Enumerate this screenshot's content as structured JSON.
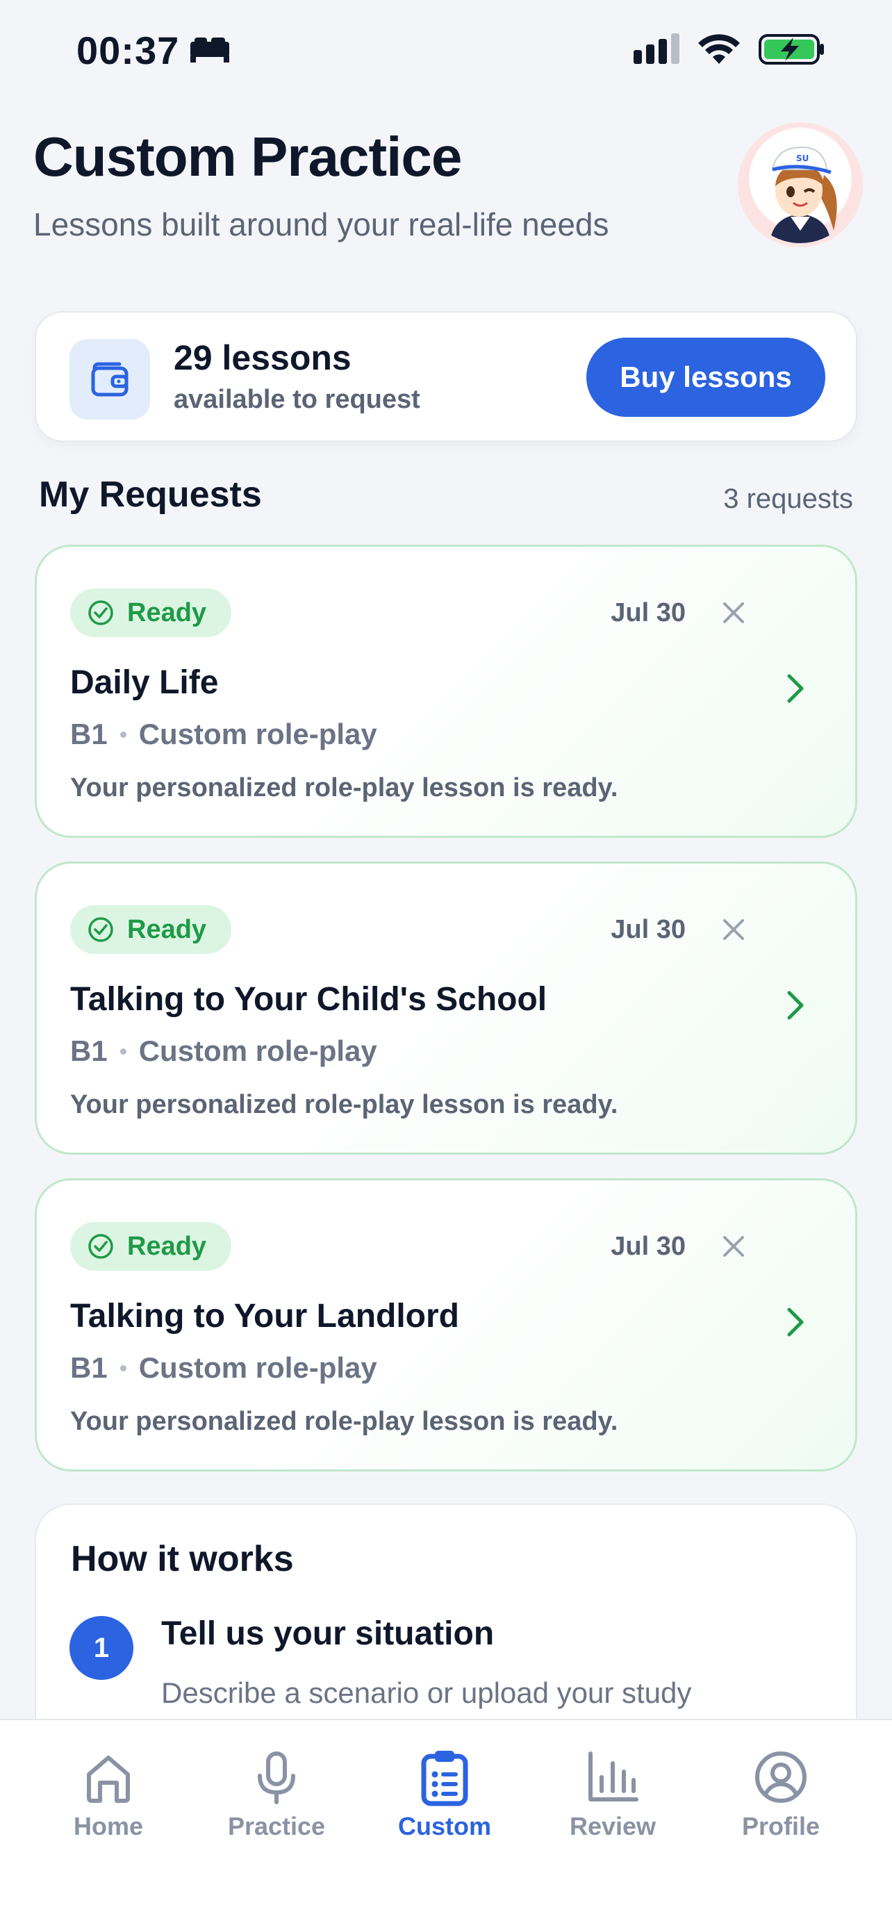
{
  "status_bar": {
    "time": "00:37"
  },
  "header": {
    "title": "Custom Practice",
    "subtitle": "Lessons built around your real-life needs"
  },
  "balance": {
    "count_label": "29 lessons",
    "sub_label": "available to request",
    "buy_label": "Buy lessons",
    "icon": "wallet-icon"
  },
  "requests_section": {
    "title": "My Requests",
    "count_label": "3 requests"
  },
  "requests": [
    {
      "status": "Ready",
      "date": "Jul 30",
      "title": "Daily Life",
      "level": "B1",
      "type": "Custom role-play",
      "description": "Your personalized role-play lesson is ready."
    },
    {
      "status": "Ready",
      "date": "Jul 30",
      "title": "Talking to Your Child's School",
      "level": "B1",
      "type": "Custom role-play",
      "description": "Your personalized role-play lesson is ready."
    },
    {
      "status": "Ready",
      "date": "Jul 30",
      "title": "Talking to Your Landlord",
      "level": "B1",
      "type": "Custom role-play",
      "description": "Your personalized role-play lesson is ready."
    }
  ],
  "how_it_works": {
    "title": "How it works",
    "steps": [
      {
        "number": "1",
        "title": "Tell us your situation",
        "description": "Describe a scenario or upload your study materials, and we'll build a custom lesson"
      }
    ]
  },
  "tabbar": {
    "items": [
      {
        "label": "Home",
        "icon": "home-icon"
      },
      {
        "label": "Practice",
        "icon": "microphone-icon"
      },
      {
        "label": "Custom",
        "icon": "clipboard-list-icon"
      },
      {
        "label": "Review",
        "icon": "bar-chart-icon"
      },
      {
        "label": "Profile",
        "icon": "user-circle-icon"
      }
    ],
    "active": "Custom"
  },
  "colors": {
    "accent": "#2b63e0",
    "ready_green": "#1f9a47",
    "ready_bg": "#dcf5e3",
    "battery_green": "#35c759"
  }
}
